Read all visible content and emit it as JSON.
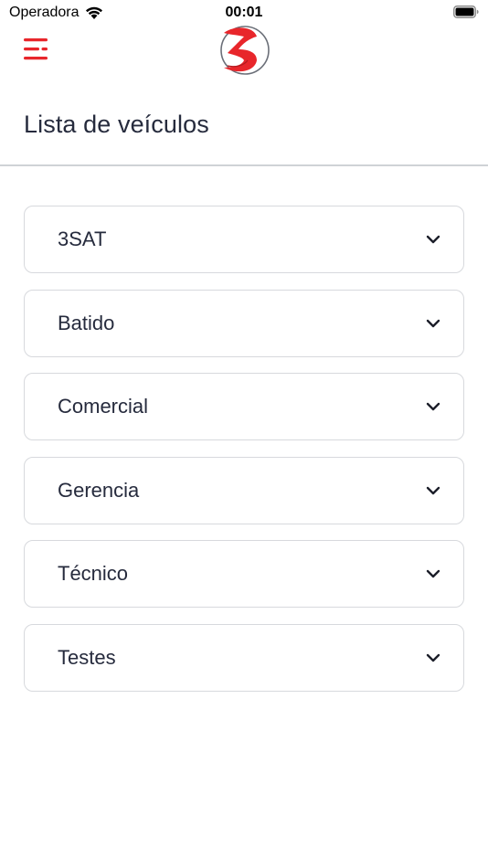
{
  "status_bar": {
    "carrier": "Operadora",
    "time": "00:01"
  },
  "header": {
    "menu_icon": "hamburger-menu-icon",
    "logo": "3sat-logo",
    "accent_color": "#e8262b"
  },
  "page": {
    "title": "Lista de veículos"
  },
  "groups": [
    {
      "label": "3SAT"
    },
    {
      "label": "Batido"
    },
    {
      "label": "Comercial"
    },
    {
      "label": "Gerencia"
    },
    {
      "label": "Técnico"
    },
    {
      "label": "Testes"
    }
  ]
}
